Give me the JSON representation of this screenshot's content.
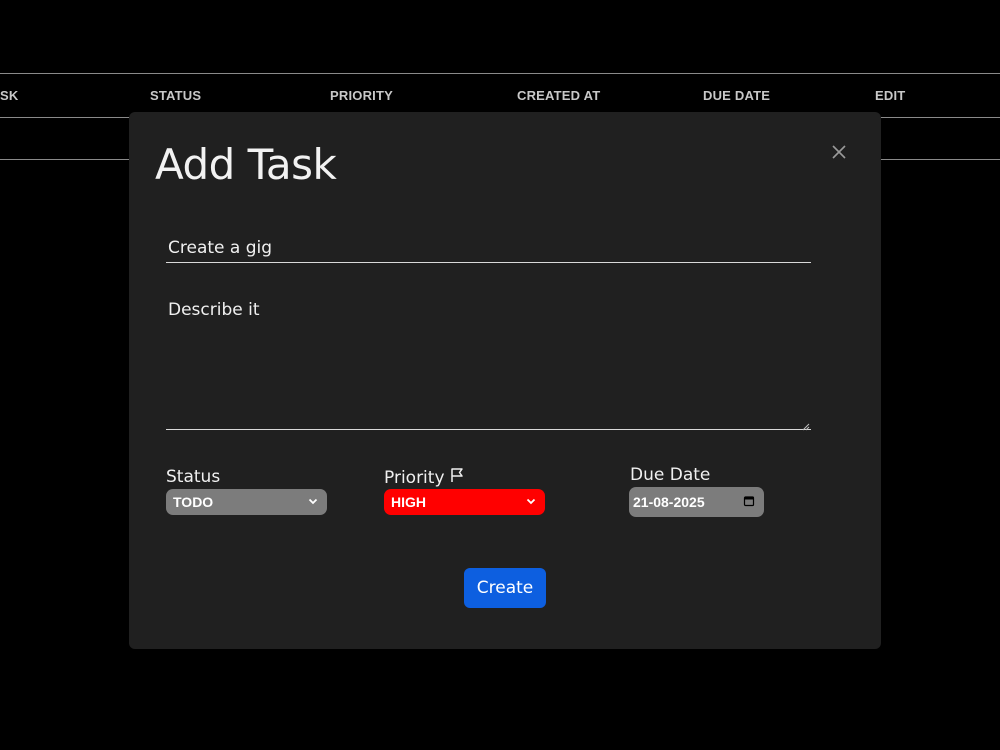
{
  "table": {
    "columns": [
      "SK",
      "STATUS",
      "PRIORITY",
      "CREATED AT",
      "DUE DATE",
      "EDIT"
    ]
  },
  "modal": {
    "title": "Add Task",
    "close_icon": "close-icon",
    "title_value": "Create a gig",
    "description_value": "Describe it",
    "status": {
      "label": "Status",
      "value": "TODO",
      "color": "#7c7c7c"
    },
    "priority": {
      "label": "Priority",
      "icon": "flag-icon",
      "value": "HIGH",
      "color": "#ff0000"
    },
    "due_date": {
      "label": "Due Date",
      "value": "21-08-2025",
      "icon": "calendar-icon"
    },
    "create_label": "Create",
    "create_color": "#0d5fe0"
  }
}
